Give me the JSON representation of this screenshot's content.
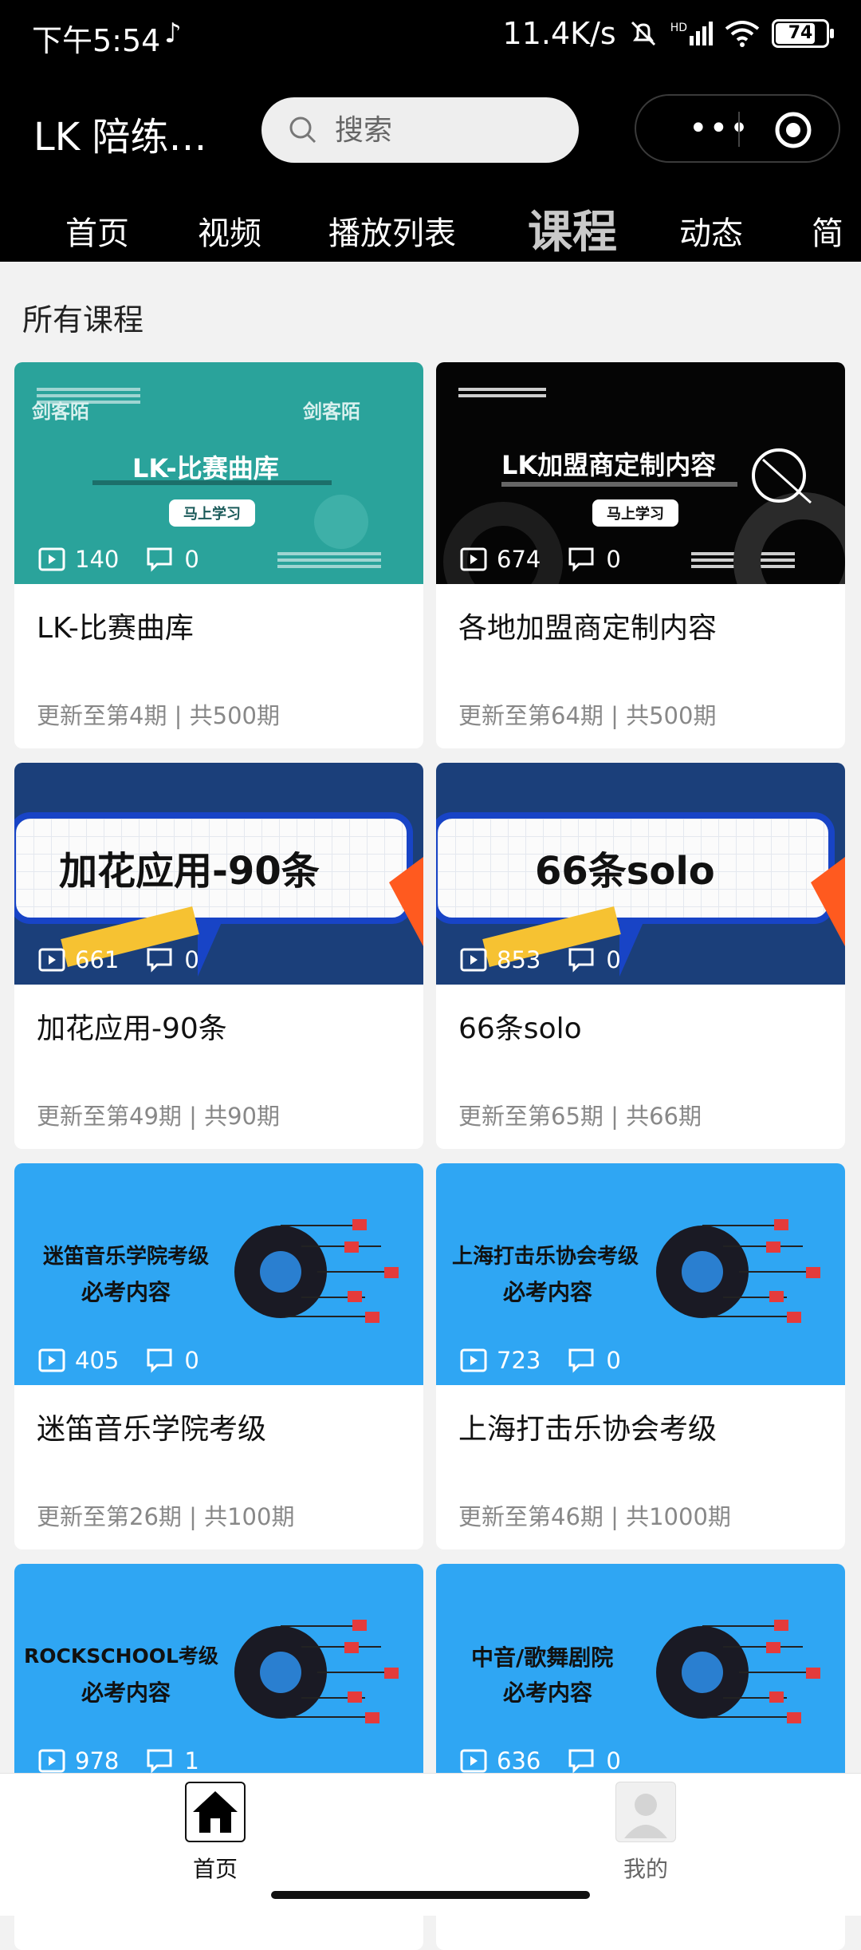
{
  "status_bar": {
    "time": "下午5:54",
    "net_speed": "11.4K/s",
    "hd_label": "HD",
    "battery": "74"
  },
  "header": {
    "app_title": "LK 陪练…",
    "search_placeholder": "搜索"
  },
  "tabs": [
    {
      "label": "首页",
      "active": false
    },
    {
      "label": "视频",
      "active": false
    },
    {
      "label": "播放列表",
      "active": false
    },
    {
      "label": "课程",
      "active": true
    },
    {
      "label": "动态",
      "active": false
    },
    {
      "label": "简",
      "active": false
    }
  ],
  "section_title": "所有课程",
  "courses": [
    {
      "title": "LK-比赛曲库",
      "meta": "更新至第4期 | 共500期",
      "views": "140",
      "comments": "0",
      "banner": "LK-比赛曲库",
      "button": "马上学习",
      "watermark": "剑客陌",
      "theme": "teal"
    },
    {
      "title": "各地加盟商定制内容",
      "meta": "更新至第64期 | 共500期",
      "views": "674",
      "comments": "0",
      "banner": "LK加盟商定制内容",
      "button": "马上学习",
      "theme": "black"
    },
    {
      "title": "加花应用-90条",
      "meta": "更新至第49期 | 共90期",
      "views": "661",
      "comments": "0",
      "banner": "加花应用-90条",
      "theme": "navy"
    },
    {
      "title": "66条solo",
      "meta": "更新至第65期 | 共66期",
      "views": "853",
      "comments": "0",
      "banner": "66条solo",
      "theme": "navy"
    },
    {
      "title": "迷笛音乐学院考级",
      "meta": "更新至第26期 | 共100期",
      "views": "405",
      "comments": "0",
      "banner_line1": "迷笛音乐学院考级",
      "banner_line2": "必考内容",
      "theme": "sky"
    },
    {
      "title": "上海打击乐协会考级",
      "meta": "更新至第46期 | 共1000期",
      "views": "723",
      "comments": "0",
      "banner_line1": "上海打击乐协会考级",
      "banner_line2": "必考内容",
      "theme": "sky"
    },
    {
      "title": "",
      "meta": "",
      "views": "978",
      "comments": "1",
      "banner_line1": "ROCKSCHOOL考级",
      "banner_line2": "必考内容",
      "theme": "sky"
    },
    {
      "title": "",
      "meta": "",
      "views": "636",
      "comments": "0",
      "banner_line1": "中音/歌舞剧院",
      "banner_line2": "必考内容",
      "theme": "sky"
    }
  ],
  "bottom_nav": [
    {
      "label": "首页",
      "icon": "home-icon",
      "active": true
    },
    {
      "label": "我的",
      "icon": "avatar-icon",
      "active": false
    }
  ],
  "colors": {
    "header_bg": "#000000",
    "page_bg": "#f2f2f2",
    "teal": "#2aa39b",
    "navy": "#1b3f7a",
    "sky": "#2fa6f3"
  }
}
